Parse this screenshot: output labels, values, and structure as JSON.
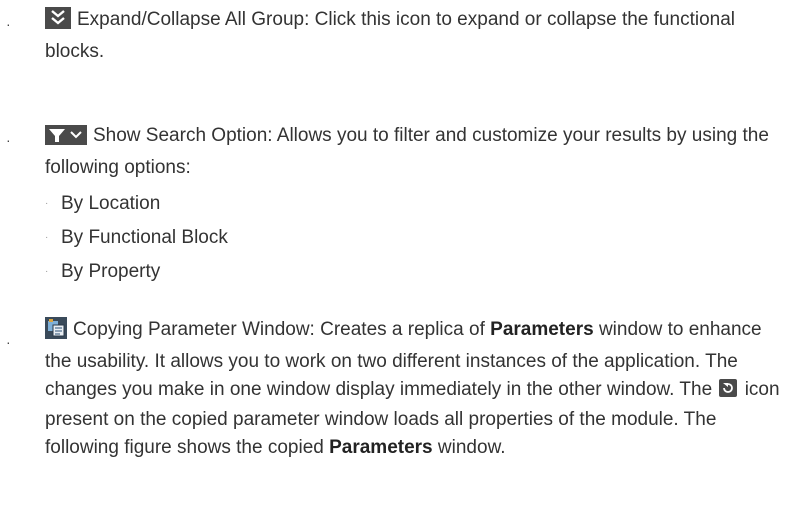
{
  "bullets": {
    "b1": "·",
    "b2": "·",
    "b3": "·"
  },
  "items": [
    {
      "icon": "double-chevron-down-icon",
      "text": "Expand/Collapse All Group: Click this icon to expand or collapse the functional blocks."
    },
    {
      "icon": "filter-dropdown-icon",
      "text": "Show Search Option: Allows you to filter and customize your results by using the following options:",
      "options": [
        "By Location",
        "By Functional Block",
        "By Property"
      ],
      "option_dot": "·"
    },
    {
      "icon": "copy-parameter-window-icon",
      "text_1": "Copying Parameter Window: Creates a replica of ",
      "bold_1": "Parameters",
      "text_2": " window to enhance the usability. It allows you to work on two different instances of the application. The changes you make in one window display immediately in the other window. The ",
      "inline_icon": "reload-icon",
      "text_3": " icon present on the copied parameter window loads all properties of the module. The following figure shows the copied ",
      "bold_2": "Parameters",
      "text_4": " window."
    }
  ],
  "colors": {
    "icon_dark": "#4a4a4a",
    "text": "#333333",
    "sub_bullet": "#9a9a9a"
  }
}
